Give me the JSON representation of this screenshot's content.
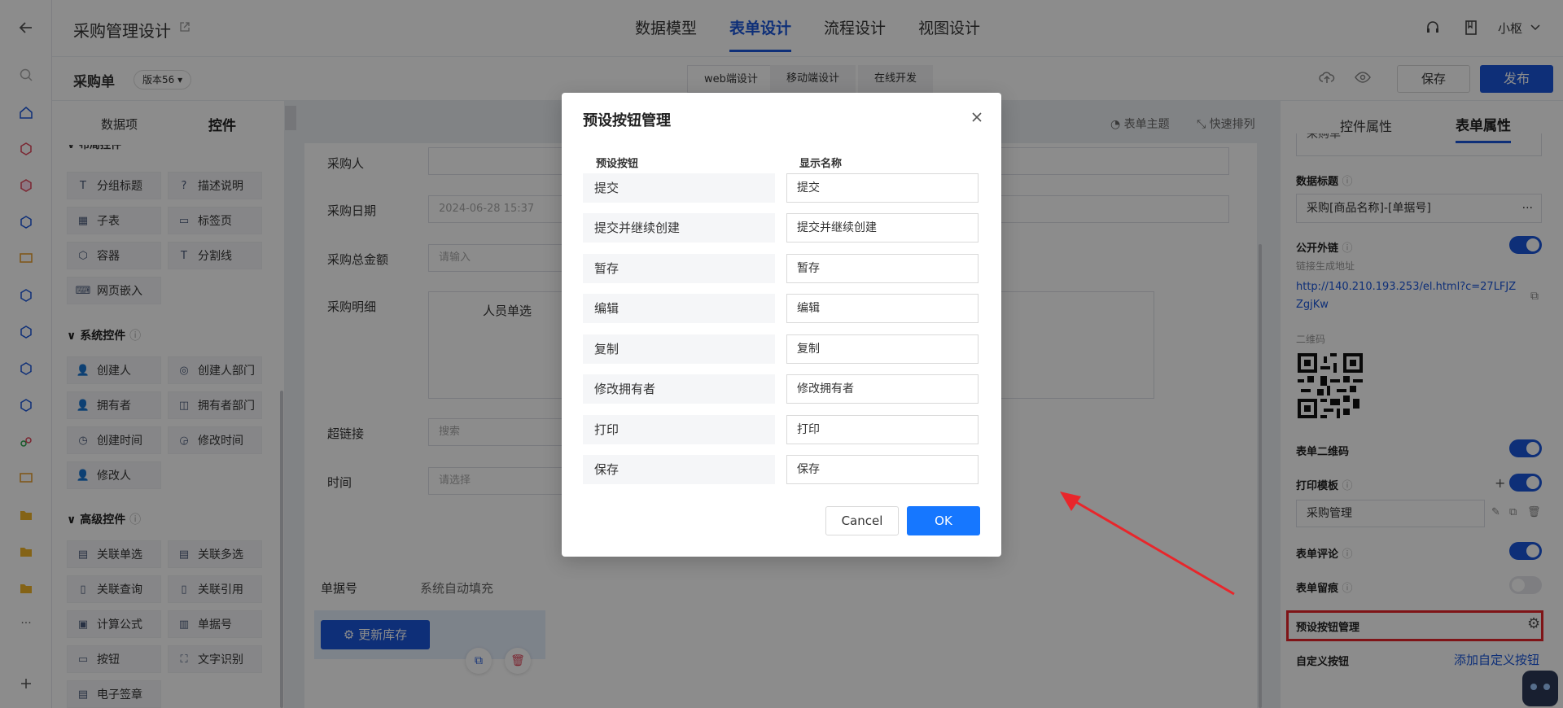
{
  "app": {
    "title": "采购管理设计",
    "user": "小枢"
  },
  "nav": {
    "tabs": [
      "数据模型",
      "表单设计",
      "流程设计",
      "视图设计"
    ],
    "active": "表单设计"
  },
  "subbar": {
    "form_name": "采购单",
    "version": "版本56",
    "segments": [
      "web端设计",
      "移动端设计",
      "在线开发"
    ],
    "save_label": "保存",
    "publish_label": "发布"
  },
  "left": {
    "tabs": [
      "数据项",
      "控件"
    ],
    "layout_controls": [
      "分组标题",
      "描述说明",
      "子表",
      "标签页",
      "容器",
      "分割线",
      "网页嵌入"
    ],
    "system_title": "系统控件",
    "system_controls": [
      "创建人",
      "创建人部门",
      "拥有者",
      "拥有者部门",
      "创建时间",
      "修改时间",
      "修改人"
    ],
    "advanced_title": "高级控件",
    "advanced_controls": [
      "关联单选",
      "关联多选",
      "关联查询",
      "关联引用",
      "计算公式",
      "单据号",
      "按钮",
      "文字识别",
      "电子签章"
    ]
  },
  "center": {
    "toolbar": [
      "表单主题",
      "快速排列"
    ],
    "fields": [
      {
        "label": "采购人",
        "placeholder": ""
      },
      {
        "label": "采购日期",
        "placeholder": "2024-06-28 15:37"
      },
      {
        "label": "采购总金额",
        "placeholder": "请输入"
      },
      {
        "label": "采购明细",
        "placeholder": ""
      },
      {
        "label": "超链接",
        "placeholder": "搜索"
      },
      {
        "label": "时间",
        "placeholder": "请选择"
      }
    ],
    "subtable_header": "人员单选",
    "doc_no_label": "单据号",
    "doc_no_value": "系统自动填充",
    "update_button": "更新库存"
  },
  "right": {
    "tabs": [
      "控件属性",
      "表单属性"
    ],
    "truncated_value": "采购单",
    "data_title_label": "数据标题",
    "data_title_value": "采购[商品名称]-[单据号]",
    "public_link_label": "公开外链",
    "link_sub_label": "链接生成地址",
    "link_url": "http://140.210.193.253/el.html?c=27LFJZZgjKw",
    "qr_label": "二维码",
    "form_qr_label": "表单二维码",
    "print_template_label": "打印模板",
    "print_template_value": "采购管理",
    "form_comment_label": "表单评论",
    "form_trace_label": "表单留痕",
    "preset_buttons_label": "预设按钮管理",
    "custom_buttons_label": "自定义按钮",
    "add_custom_button": "添加自定义按钮"
  },
  "modal": {
    "title": "预设按钮管理",
    "col_preset": "预设按钮",
    "col_display": "显示名称",
    "rows": [
      {
        "preset": "提交",
        "display": "提交"
      },
      {
        "preset": "提交并继续创建",
        "display": "提交并继续创建"
      },
      {
        "preset": "暂存",
        "display": "暂存"
      },
      {
        "preset": "编辑",
        "display": "编辑"
      },
      {
        "preset": "复制",
        "display": "复制"
      },
      {
        "preset": "修改拥有者",
        "display": "修改拥有者"
      },
      {
        "preset": "打印",
        "display": "打印"
      },
      {
        "preset": "保存",
        "display": "保存"
      }
    ],
    "cancel": "Cancel",
    "ok": "OK"
  },
  "colors": {
    "accent": "#1a56db",
    "highlight": "#e8262b"
  }
}
